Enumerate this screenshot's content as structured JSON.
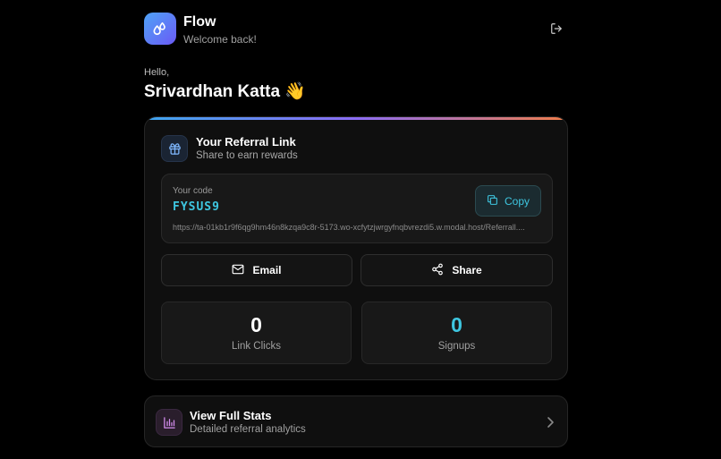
{
  "header": {
    "app_name": "Flow",
    "subtitle": "Welcome back!",
    "logo_icon": "drops-icon",
    "logout_icon": "logout-icon"
  },
  "greeting": {
    "hello": "Hello,",
    "name": "Srivardhan Katta 👋"
  },
  "referral": {
    "title": "Your Referral Link",
    "subtitle": "Share to earn rewards",
    "icon": "gift-icon",
    "code_label": "Your code",
    "code": "FYSUS9",
    "copy_label": "Copy",
    "url": "https://ta-01kb1r9f6qg9hm46n8kzqa9c8r-5173.wo-xcfytzjwrgyfnqbvrezdi5.w.modal.host/Referrall....",
    "email_label": "Email",
    "share_label": "Share"
  },
  "stats": {
    "link_clicks_value": "0",
    "link_clicks_label": "Link Clicks",
    "signups_value": "0",
    "signups_label": "Signups"
  },
  "full_stats": {
    "title": "View Full Stats",
    "subtitle": "Detailed referral analytics",
    "icon": "bar-chart-icon"
  },
  "colors": {
    "accent_cyan": "#3ec6e0",
    "gradient": [
      "#3ea6f0",
      "#8b6cf5",
      "#f07d4a"
    ]
  }
}
